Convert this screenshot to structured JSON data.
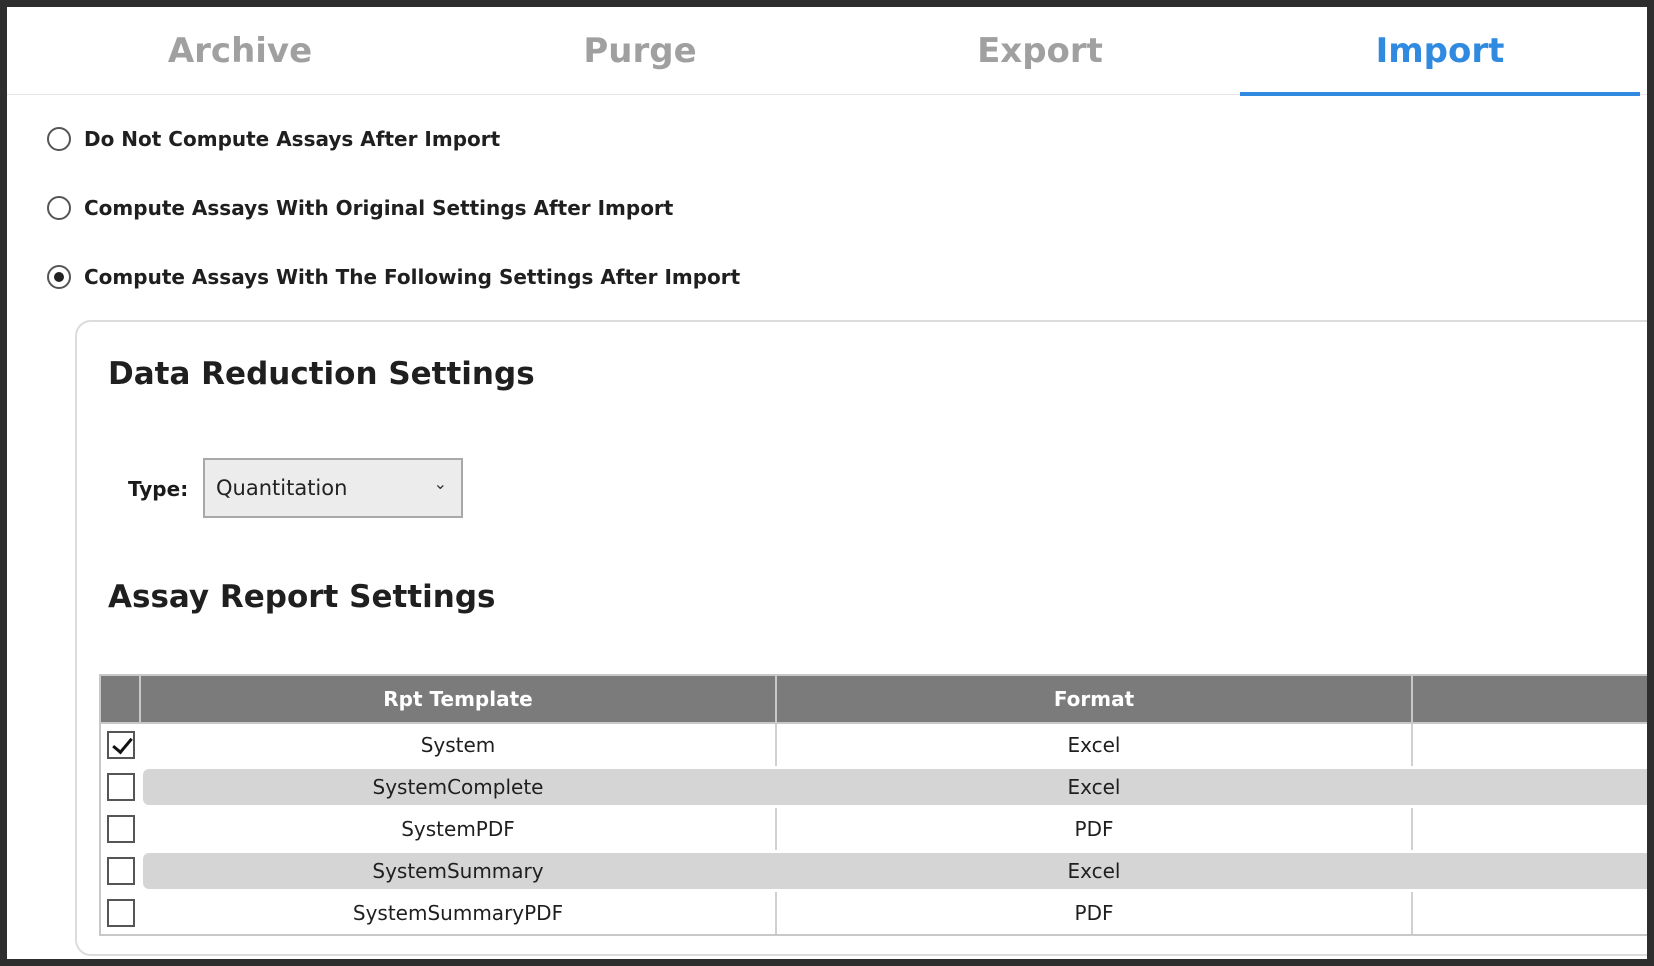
{
  "tabs": [
    {
      "label": "Archive",
      "active": false
    },
    {
      "label": "Purge",
      "active": false
    },
    {
      "label": "Export",
      "active": false
    },
    {
      "label": "Import",
      "active": true
    }
  ],
  "compute_options": [
    {
      "label": "Do Not Compute Assays After Import",
      "selected": false
    },
    {
      "label": "Compute Assays With Original Settings After Import",
      "selected": false
    },
    {
      "label": "Compute Assays With The Following Settings After Import",
      "selected": true
    }
  ],
  "data_reduction": {
    "title": "Data Reduction Settings",
    "type_label": "Type:",
    "type_value": "Quantitation"
  },
  "assay_report": {
    "title": "Assay Report Settings",
    "columns": [
      "Rpt Template",
      "Format",
      ""
    ],
    "rows": [
      {
        "template": "System",
        "format": "Excel",
        "checked": true
      },
      {
        "template": "SystemComplete",
        "format": "Excel",
        "checked": false
      },
      {
        "template": "SystemPDF",
        "format": "PDF",
        "checked": false
      },
      {
        "template": "SystemSummary",
        "format": "Excel",
        "checked": false
      },
      {
        "template": "SystemSummaryPDF",
        "format": "PDF",
        "checked": false
      }
    ]
  },
  "colors": {
    "accent": "#2f8ae0",
    "tab_inactive": "#a0a0a0",
    "table_header": "#7b7b7b",
    "row_band": "#d5d5d5"
  }
}
